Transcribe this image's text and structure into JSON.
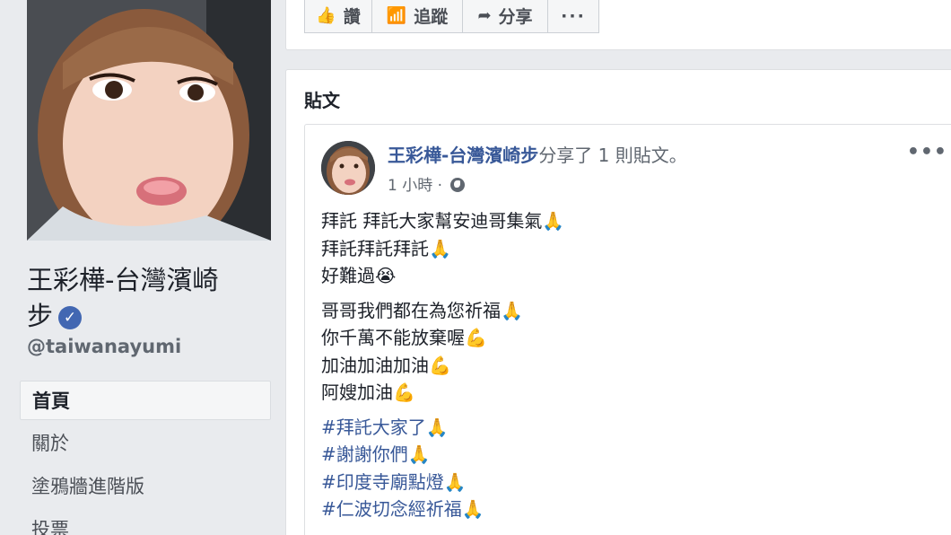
{
  "page": {
    "name_line1": "王彩樺-台灣濱崎",
    "name_line2": "步",
    "verified_mark": "✓",
    "username": "@taiwanayumi"
  },
  "nav": {
    "items": [
      {
        "label": "首頁",
        "active": true
      },
      {
        "label": "關於",
        "active": false
      },
      {
        "label": "塗鴉牆進階版",
        "active": false
      },
      {
        "label": "投票",
        "active": false
      }
    ]
  },
  "actions": {
    "like_icon": "👍",
    "like_label": "讚",
    "follow_icon": "📶",
    "follow_label": "追蹤",
    "share_icon": "➦",
    "share_label": "分享",
    "more_label": "···"
  },
  "posts": {
    "heading": "貼文"
  },
  "post": {
    "author": "王彩樺-台灣濱崎步",
    "shared_text": "分享了 1 則貼文。",
    "time": "1 小時 · ",
    "globe_icon": "globe-icon",
    "more_label": "•••",
    "paragraphs": [
      [
        "拜託 拜託大家幫安迪哥集氣🙏",
        "拜託拜託拜託🙏",
        "好難過😭"
      ],
      [
        "哥哥我們都在為您祈福🙏",
        "你千萬不能放棄喔💪",
        "加油加油加油💪",
        "阿嫂加油💪"
      ]
    ],
    "hashtags": [
      "#拜託大家了🙏",
      "#謝謝你們🙏",
      "#印度寺廟點燈🙏",
      "#仁波切念經祈福🙏"
    ]
  },
  "colors": {
    "background": "#e9ebee",
    "link_blue": "#385898",
    "verified_blue": "#4267b2",
    "muted_text": "#606770"
  }
}
